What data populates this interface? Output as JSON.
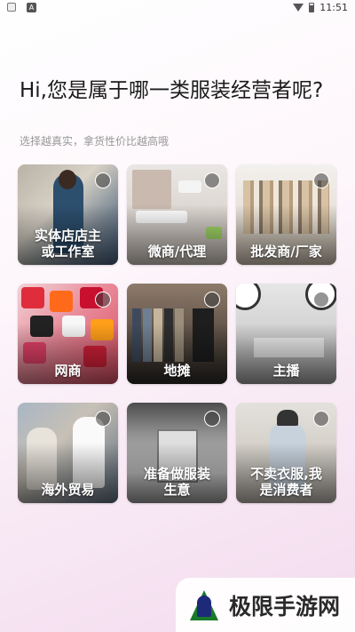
{
  "status_bar": {
    "time": "11:51"
  },
  "title": "Hi,您是属于哪一类服装经营者呢?",
  "subtitle": "选择越真实，拿货性价比越高哦",
  "categories": [
    {
      "label": "实体店店主\n或工作室"
    },
    {
      "label": "微商/代理"
    },
    {
      "label": "批发商/厂家"
    },
    {
      "label": "网商"
    },
    {
      "label": "地摊"
    },
    {
      "label": "主播"
    },
    {
      "label": "海外贸易"
    },
    {
      "label": "准备做服装\n生意"
    },
    {
      "label": "不卖衣服,我\n是消费者"
    }
  ],
  "watermark": {
    "text": "极限手游网"
  },
  "colors": {
    "accent": "#1a7a2a",
    "page_bg": "#f7e6f3"
  }
}
